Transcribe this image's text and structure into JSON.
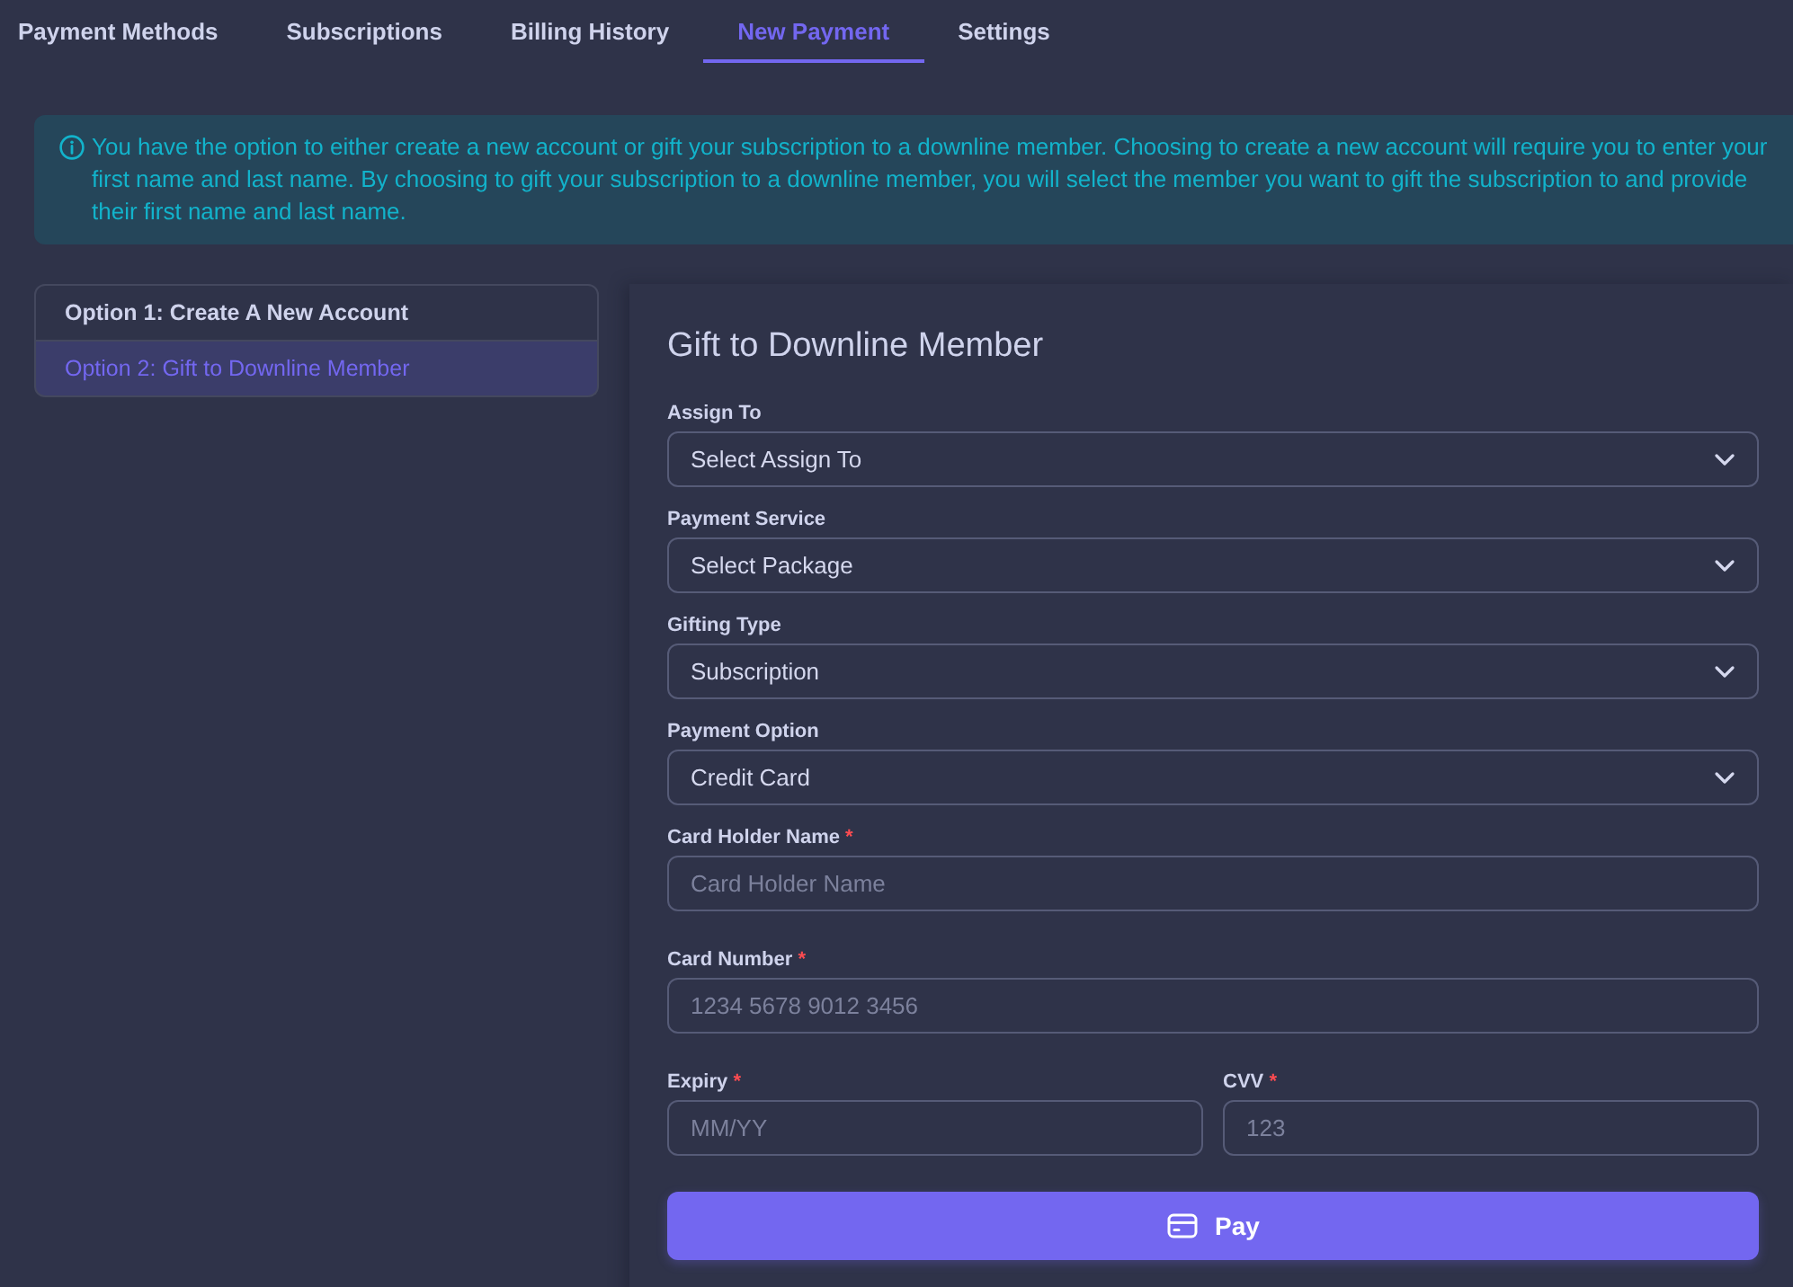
{
  "tabs": [
    {
      "label": "Payment Methods",
      "selected": false
    },
    {
      "label": "Subscriptions",
      "selected": false
    },
    {
      "label": "Billing History",
      "selected": false
    },
    {
      "label": "New Payment",
      "selected": true
    },
    {
      "label": "Settings",
      "selected": false
    }
  ],
  "alert": {
    "text": "You have the option to either create a new account or gift your subscription to a downline member. Choosing to create a new account will require you to enter your first name and last name. By choosing to gift your subscription to a downline member, you will select the member you want to gift the subscription to and provide their first name and last name."
  },
  "options": [
    {
      "label": "Option 1: Create A New Account",
      "selected": false
    },
    {
      "label": "Option 2: Gift to Downline Member",
      "selected": true
    }
  ],
  "form": {
    "title": "Gift to Downline Member",
    "fields": [
      {
        "kind": "select",
        "label": "Assign To",
        "value": "Select Assign To"
      },
      {
        "kind": "select",
        "label": "Payment Service",
        "value": "Select Package"
      },
      {
        "kind": "select",
        "label": "Gifting Type",
        "value": "Subscription"
      },
      {
        "kind": "select",
        "label": "Payment Option",
        "value": "Credit Card"
      },
      {
        "kind": "input",
        "label": "Card Holder Name",
        "required_mark": "*",
        "placeholder": "Card Holder Name"
      },
      {
        "kind": "input",
        "label": "Card Number",
        "required_mark": "*",
        "placeholder": "1234 5678 9012 3456"
      },
      {
        "kind": "pair",
        "fields": [
          {
            "kind": "input",
            "label": "Expiry",
            "required_mark": "*",
            "placeholder": "MM/YY"
          },
          {
            "kind": "input",
            "label": "CVV",
            "required_mark": "*",
            "placeholder": "123"
          }
        ]
      }
    ],
    "submit": {
      "label": "Pay"
    }
  }
}
